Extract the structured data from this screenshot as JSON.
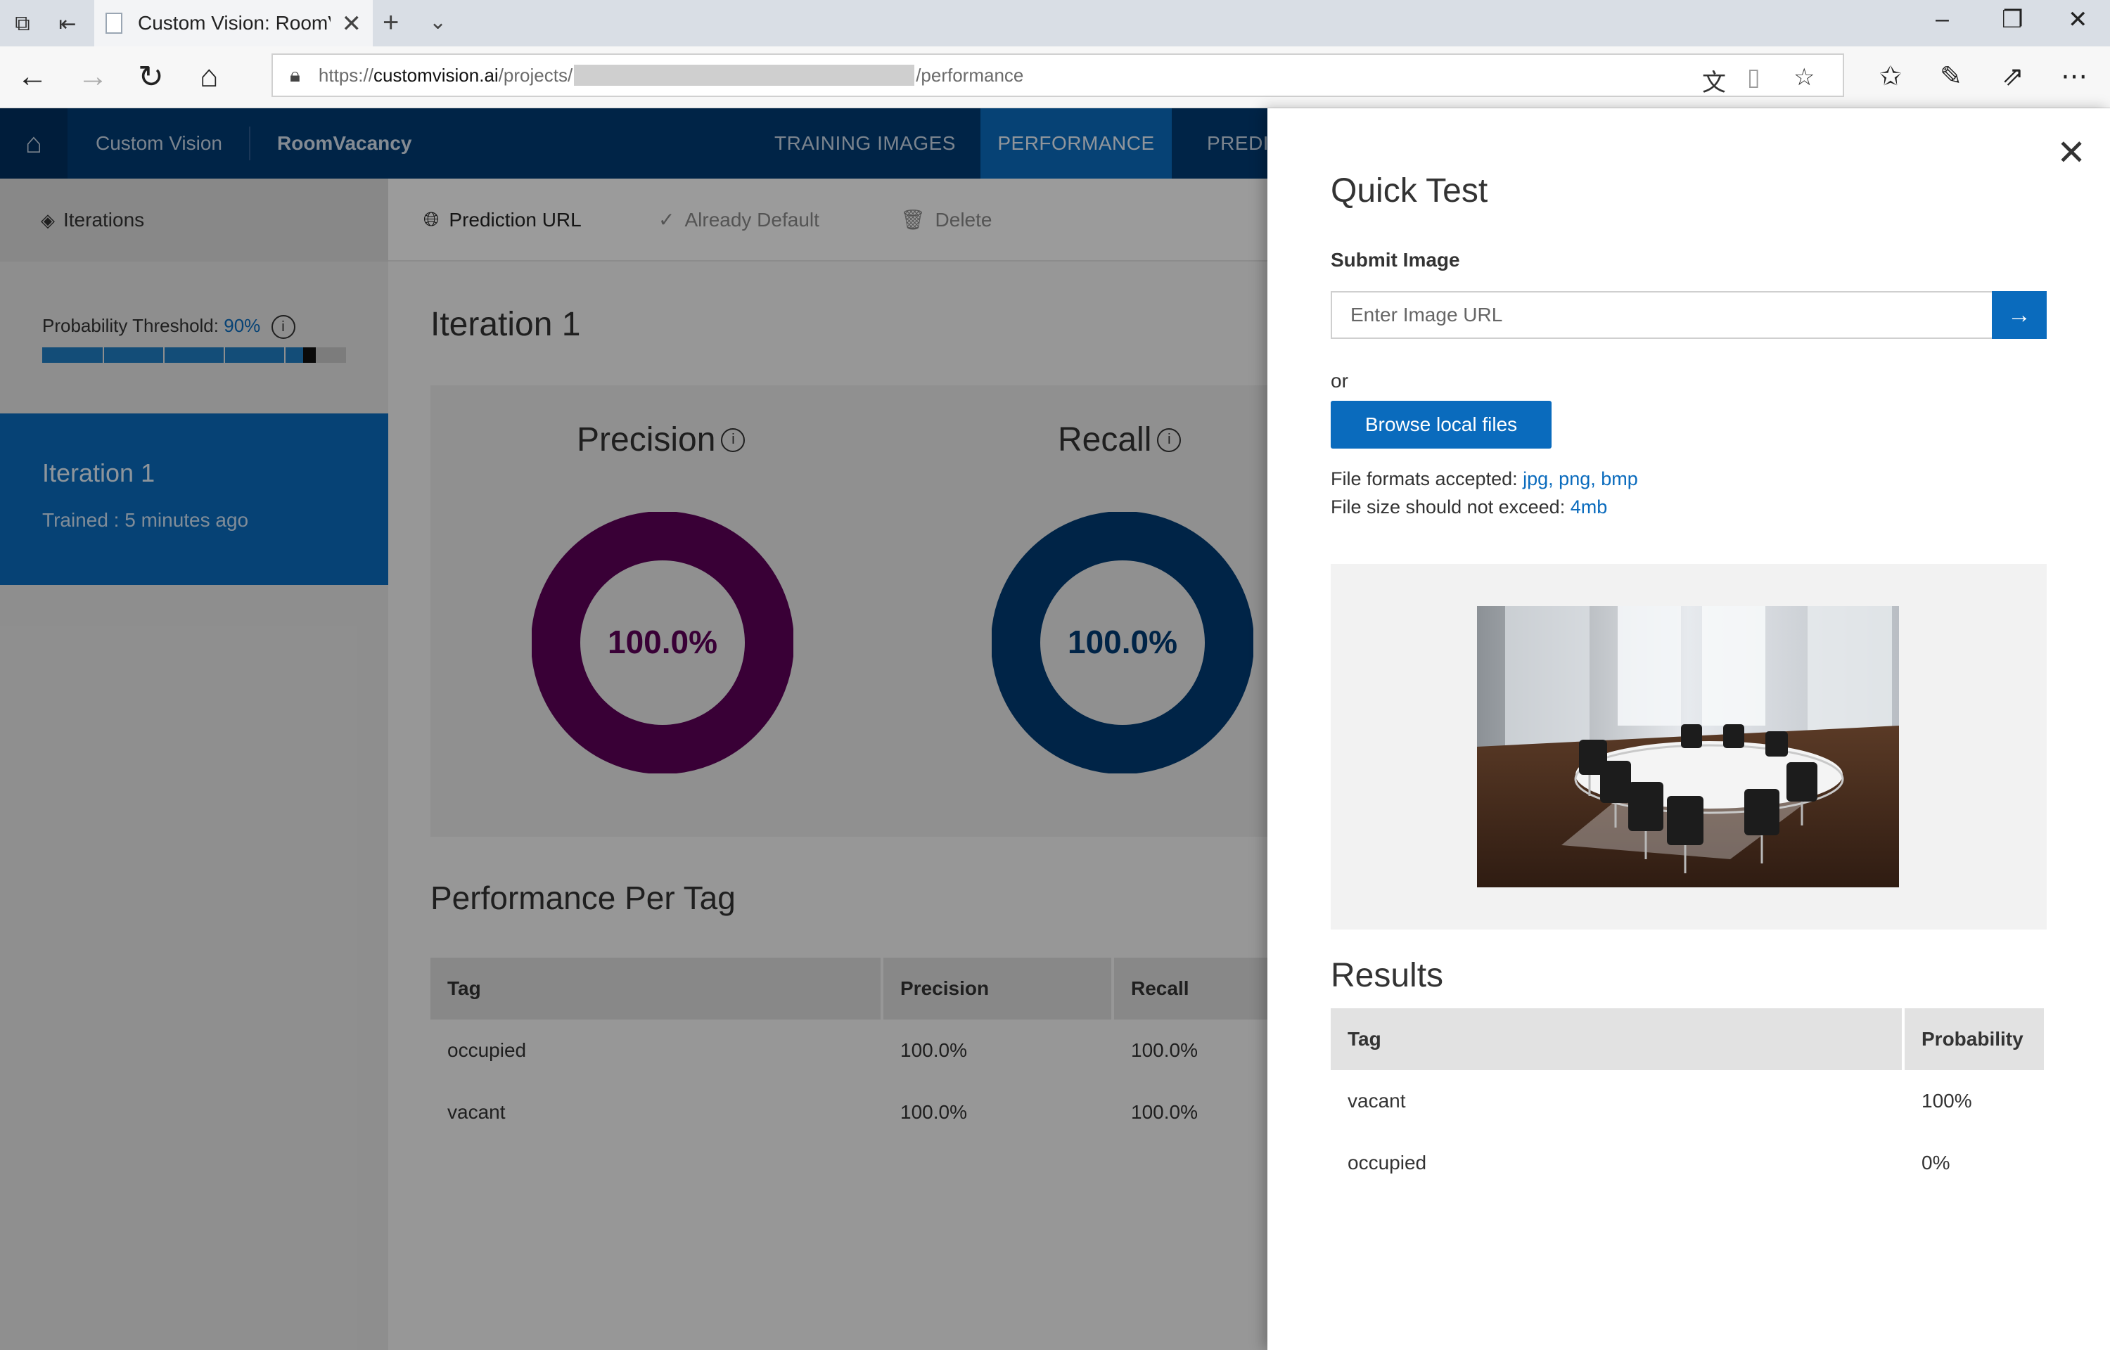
{
  "browser": {
    "tab_title": "Custom Vision: RoomVa",
    "url_prefix": "https://",
    "url_domain": "customvision.ai",
    "url_path_start": "/projects/",
    "url_path_end": "/performance"
  },
  "header": {
    "brand": "Custom Vision",
    "project": "RoomVacancy",
    "tabs": [
      {
        "label": "TRAINING IMAGES"
      },
      {
        "label": "PERFORMANCE"
      },
      {
        "label": "PREDICTIONS"
      }
    ]
  },
  "sidebar": {
    "iterations_label": "Iterations",
    "threshold_label": "Probability Threshold:",
    "threshold_value": "90%",
    "threshold_fraction": 0.9,
    "iteration_name": "Iteration 1",
    "iteration_trained": "Trained : 5 minutes ago"
  },
  "toolbar": {
    "prediction_url": "Prediction URL",
    "already_default": "Already Default",
    "delete": "Delete"
  },
  "main": {
    "title": "Iteration 1",
    "precision_label": "Precision",
    "recall_label": "Recall",
    "precision_value": "100.0%",
    "recall_value": "100.0%",
    "precision_fraction": 1.0,
    "recall_fraction": 1.0,
    "precision_color": "#5c0058",
    "recall_color": "#003a73",
    "per_tag_title": "Performance Per Tag",
    "table": {
      "headers": [
        "Tag",
        "Precision",
        "Recall"
      ],
      "rows": [
        [
          "occupied",
          "100.0%",
          "100.0%"
        ],
        [
          "vacant",
          "100.0%",
          "100.0%"
        ]
      ]
    }
  },
  "panel": {
    "title": "Quick Test",
    "submit_label": "Submit Image",
    "url_placeholder": "Enter Image URL",
    "or": "or",
    "browse": "Browse local files",
    "formats_label": "File formats accepted:",
    "formats": "jpg, png, bmp",
    "size_label": "File size should not exceed:",
    "size": "4mb",
    "results_title": "Results",
    "results": {
      "headers": [
        "Tag",
        "Probability"
      ],
      "rows": [
        [
          "vacant",
          "100%"
        ],
        [
          "occupied",
          "0%"
        ]
      ]
    }
  },
  "colors": {
    "accent": "#0a6bbd",
    "header_bg": "#003a73"
  }
}
